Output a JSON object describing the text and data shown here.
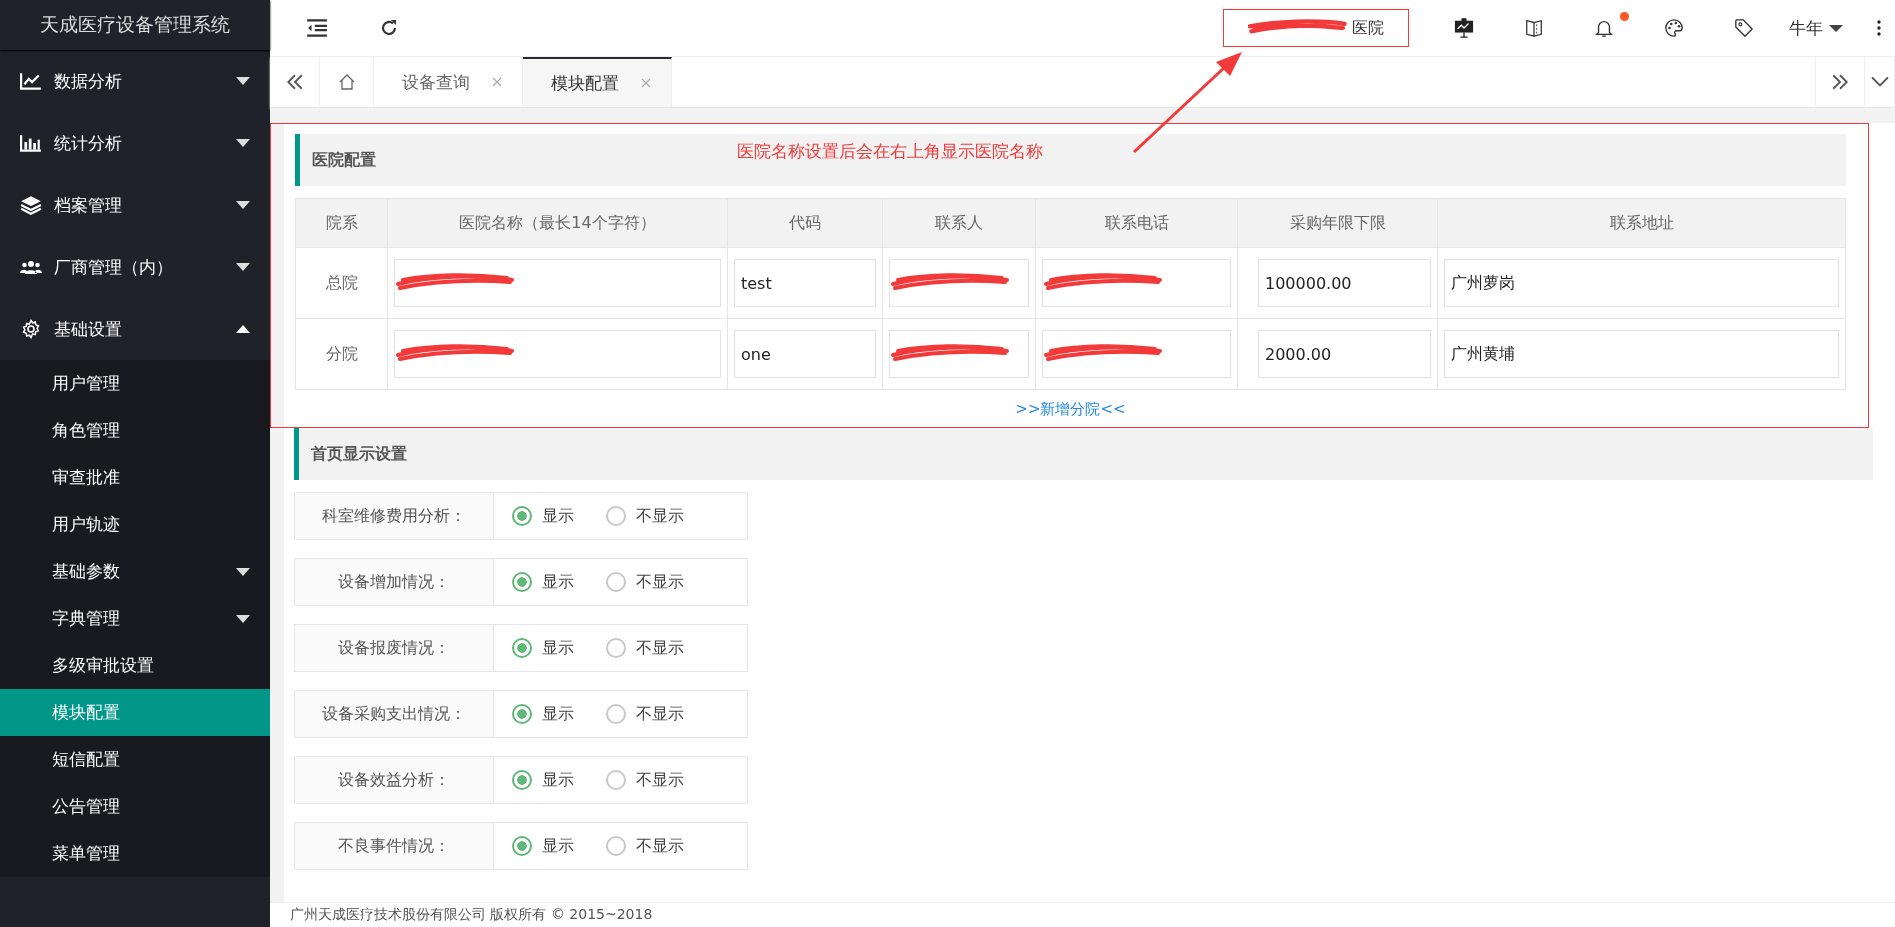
{
  "sidebar": {
    "title": "天成医疗设备管理系统",
    "menu": [
      {
        "label": "数据分析",
        "kind": "line-chart",
        "expanded": false
      },
      {
        "label": "统计分析",
        "kind": "bar-chart",
        "expanded": false
      },
      {
        "label": "档案管理",
        "kind": "layers",
        "expanded": false
      },
      {
        "label": "厂商管理（内）",
        "kind": "users",
        "expanded": false
      },
      {
        "label": "基础设置",
        "kind": "gear",
        "expanded": true,
        "children": [
          {
            "label": "用户管理",
            "selected": false,
            "expandable": false
          },
          {
            "label": "角色管理",
            "selected": false,
            "expandable": false
          },
          {
            "label": "审查批准",
            "selected": false,
            "expandable": false
          },
          {
            "label": "用户轨迹",
            "selected": false,
            "expandable": false
          },
          {
            "label": "基础参数",
            "selected": false,
            "expandable": true
          },
          {
            "label": "字典管理",
            "selected": false,
            "expandable": true
          },
          {
            "label": "多级审批设置",
            "selected": false,
            "expandable": false
          },
          {
            "label": "模块配置",
            "selected": true,
            "expandable": false
          },
          {
            "label": "短信配置",
            "selected": false,
            "expandable": false
          },
          {
            "label": "公告管理",
            "selected": false,
            "expandable": false
          },
          {
            "label": "菜单管理",
            "selected": false,
            "expandable": false
          }
        ]
      }
    ]
  },
  "topbar": {
    "hospital_name": {
      "text": "医院",
      "redacted": true
    },
    "has_unread": true,
    "user": "牛年"
  },
  "tabs": [
    {
      "label": "设备查询",
      "selected": false
    },
    {
      "label": "模块配置",
      "selected": true
    }
  ],
  "hospital_config": {
    "title": "医院配置",
    "annotation": "医院名称设置后会在右上角显示医院名称",
    "columns": [
      "院系",
      "医院名称（最长14个字符）",
      "代码",
      "联系人",
      "联系电话",
      "采购年限下限",
      "联系地址"
    ],
    "rows": [
      {
        "branch": "总院",
        "fields": [
          {
            "redacted": true
          },
          {
            "value": "test",
            "redacted": false
          },
          {
            "redacted": true
          },
          {
            "redacted": true
          },
          {
            "value": "100000.00",
            "redacted": false
          },
          {
            "value": "广州萝岗",
            "redacted": false
          }
        ]
      },
      {
        "branch": "分院",
        "fields": [
          {
            "redacted": true
          },
          {
            "value": "one",
            "redacted": false
          },
          {
            "redacted": true
          },
          {
            "redacted": true
          },
          {
            "value": "2000.00",
            "redacted": false
          },
          {
            "value": "广州黄埔",
            "redacted": false
          }
        ]
      }
    ],
    "add_link": ">>新增分院<<"
  },
  "display_settings": {
    "title": "首页显示设置",
    "rows": [
      {
        "label": "科室维修费用分析：",
        "options": [
          {
            "label": "显示",
            "selected": true
          },
          {
            "label": "不显示",
            "selected": false
          }
        ]
      },
      {
        "label": "设备增加情况：",
        "options": [
          {
            "label": "显示",
            "selected": true
          },
          {
            "label": "不显示",
            "selected": false
          }
        ]
      },
      {
        "label": "设备报废情况：",
        "options": [
          {
            "label": "显示",
            "selected": true
          },
          {
            "label": "不显示",
            "selected": false
          }
        ]
      },
      {
        "label": "设备采购支出情况：",
        "options": [
          {
            "label": "显示",
            "selected": true
          },
          {
            "label": "不显示",
            "selected": false
          }
        ]
      },
      {
        "label": "设备效益分析：",
        "options": [
          {
            "label": "显示",
            "selected": true
          },
          {
            "label": "不显示",
            "selected": false
          }
        ]
      },
      {
        "label": "不良事件情况：",
        "options": [
          {
            "label": "显示",
            "selected": true
          },
          {
            "label": "不显示",
            "selected": false
          }
        ]
      }
    ]
  },
  "footer": "广州天成医疗技术股份有限公司 版权所有 © 2015~2018"
}
